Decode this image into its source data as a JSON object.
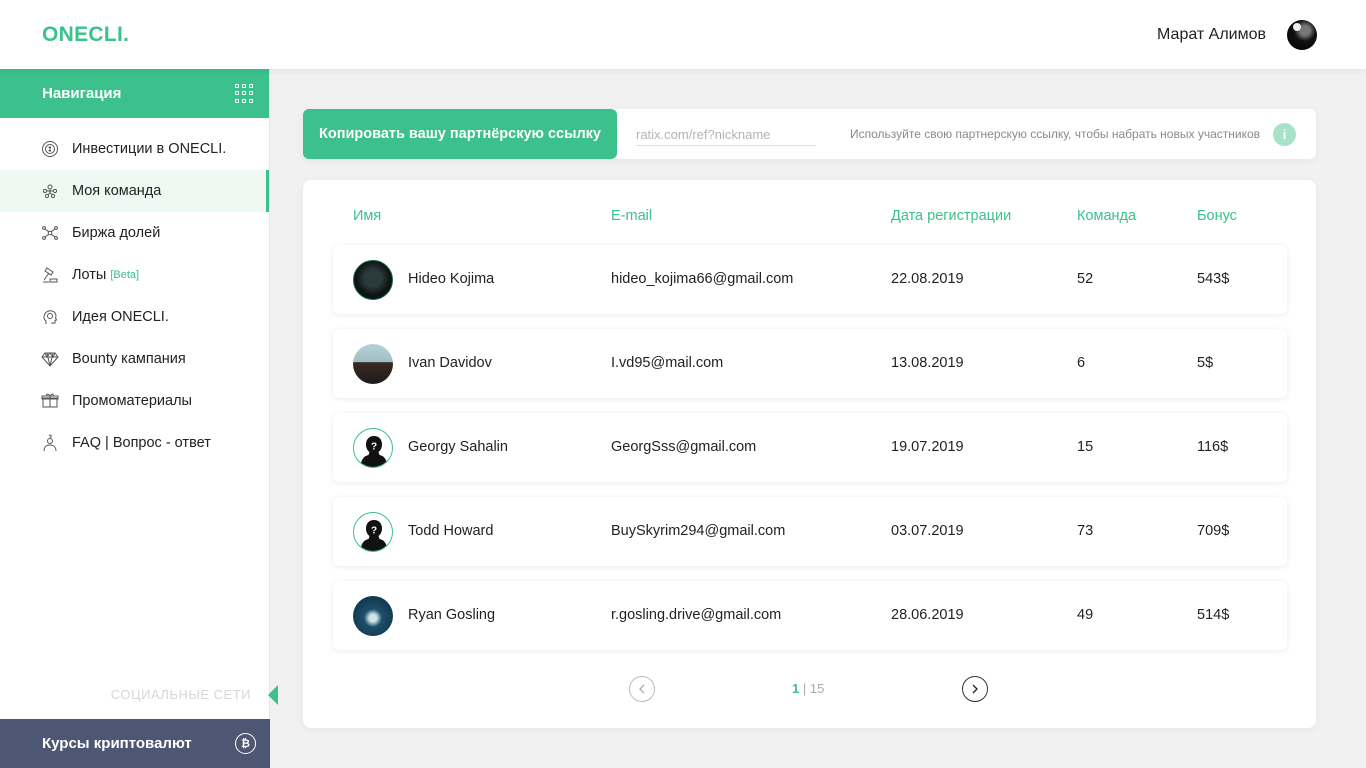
{
  "app": {
    "logo": "ONECLI."
  },
  "user": {
    "name": "Марат Алимов"
  },
  "sidebar": {
    "header": "Навигация",
    "items": [
      {
        "label": "Инвестиции в ONECLI.",
        "icon": "coin-stack-icon",
        "active": false
      },
      {
        "label": "Моя команда",
        "icon": "team-icon",
        "active": true
      },
      {
        "label": "Биржа долей",
        "icon": "exchange-icon",
        "active": false
      },
      {
        "label": "Лоты",
        "badge": "[Beta]",
        "icon": "auction-icon",
        "active": false
      },
      {
        "label": "Идея ONECLI.",
        "icon": "idea-head-icon",
        "active": false
      },
      {
        "label": "Bounty кампания",
        "icon": "diamond-icon",
        "active": false
      },
      {
        "label": "Промоматериалы",
        "icon": "gift-icon",
        "active": false
      },
      {
        "label": "FAQ | Вопрос - ответ",
        "icon": "faq-person-icon",
        "active": false
      }
    ],
    "social_label": "СОЦИАЛЬНЫЕ СЕТИ",
    "crypto_label": "Курсы криптовалют"
  },
  "referral": {
    "button_label": "Копировать вашу партнёрскую ссылку",
    "input_placeholder": "ratix.com/ref?nickname",
    "hint": "Используйте свою партнерскую ссылку, чтобы набрать новых участников",
    "info_icon": "i"
  },
  "table": {
    "headers": {
      "name": "Имя",
      "email": "E-mail",
      "date": "Дата регистрации",
      "team": "Команда",
      "bonus": "Бонус"
    },
    "rows": [
      {
        "name": "Hideo Kojima",
        "email": "hideo_kojima66@gmail.com",
        "date": "22.08.2019",
        "team": "52",
        "bonus": "543$"
      },
      {
        "name": "Ivan Davidov",
        "email": "I.vd95@mail.com",
        "date": "13.08.2019",
        "team": "6",
        "bonus": "5$"
      },
      {
        "name": "Georgy Sahalin",
        "email": "GeorgSss@gmail.com",
        "date": "19.07.2019",
        "team": "15",
        "bonus": "116$"
      },
      {
        "name": "Todd Howard",
        "email": "BuySkyrim294@gmail.com",
        "date": "03.07.2019",
        "team": "73",
        "bonus": "709$"
      },
      {
        "name": "Ryan Gosling",
        "email": "r.gosling.drive@gmail.com",
        "date": "28.06.2019",
        "team": "49",
        "bonus": "514$"
      }
    ]
  },
  "pagination": {
    "current": "1",
    "separator": " | ",
    "total": "15"
  },
  "colors": {
    "accent": "#3cc08c",
    "dark": "#4d5672"
  }
}
